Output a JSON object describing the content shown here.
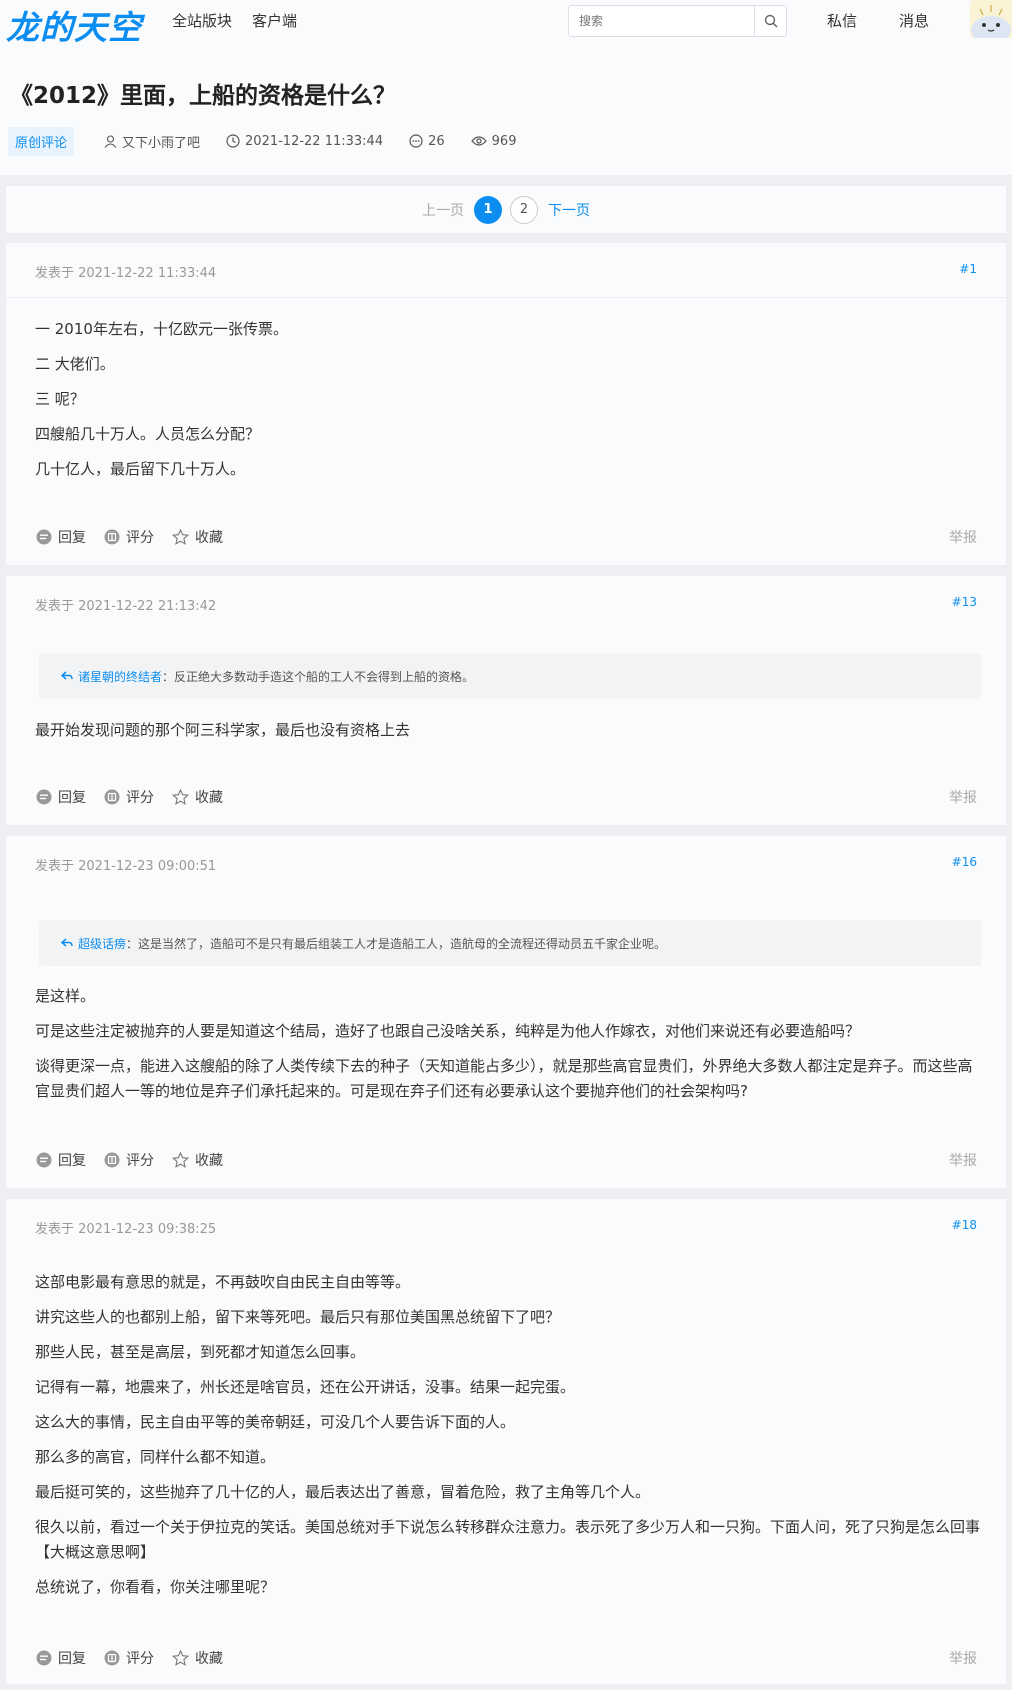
{
  "header": {
    "logo": "龙的天空",
    "nav": [
      "全站版块",
      "客户端"
    ],
    "search_placeholder": "搜索",
    "messages": "私信",
    "notifications": "消息"
  },
  "thread": {
    "title": "《2012》里面，上船的资格是什么？",
    "tag": "原创评论",
    "author": "又下小雨了吧",
    "datetime": "2021-12-22 11:33:44",
    "comments": "26",
    "views": "969"
  },
  "pagination": {
    "prev": "上一页",
    "pages": [
      "1",
      "2"
    ],
    "next": "下一页"
  },
  "actions": {
    "reply": "回复",
    "rate": "评分",
    "favorite": "收藏",
    "report": "举报"
  },
  "posts": [
    {
      "time": "发表于 2021-12-22 11:33:44",
      "floor": "#1",
      "quote": null,
      "paragraphs": [
        "一 2010年左右，十亿欧元一张传票。",
        "二 大佬们。",
        "三 呢？",
        "四艘船几十万人。人员怎么分配？",
        "几十亿人，最后留下几十万人。"
      ]
    },
    {
      "time": "发表于 2021-12-22 21:13:42",
      "floor": "#13",
      "quote": {
        "name": "诸星朝的终结者",
        "text": "：反正绝大多数动手造这个船的工人不会得到上船的资格。"
      },
      "paragraphs": [
        "最开始发现问题的那个阿三科学家，最后也没有资格上去"
      ]
    },
    {
      "time": "发表于 2021-12-23 09:00:51",
      "floor": "#16",
      "quote": {
        "name": "超级话痨",
        "text": "：这是当然了，造船可不是只有最后组装工人才是造船工人，造航母的全流程还得动员五千家企业呢。"
      },
      "paragraphs": [
        "是这样。",
        "可是这些注定被抛弃的人要是知道这个结局，造好了也跟自己没啥关系，纯粹是为他人作嫁衣，对他们来说还有必要造船吗？",
        "谈得更深一点，能进入这艘船的除了人类传续下去的种子（天知道能占多少），就是那些高官显贵们，外界绝大多数人都注定是弃子。而这些高官显贵们超人一等的地位是弃子们承托起来的。可是现在弃子们还有必要承认这个要抛弃他们的社会架构吗?"
      ]
    },
    {
      "time": "发表于 2021-12-23 09:38:25",
      "floor": "#18",
      "quote": null,
      "paragraphs": [
        "这部电影最有意思的就是，不再鼓吹自由民主自由等等。",
        "讲究这些人的也都别上船，留下来等死吧。最后只有那位美国黑总统留下了吧？",
        "那些人民，甚至是高层，到死都才知道怎么回事。",
        "记得有一幕，地震来了，州长还是啥官员，还在公开讲话，没事。结果一起完蛋。",
        "这么大的事情，民主自由平等的美帝朝廷，可没几个人要告诉下面的人。",
        "那么多的高官，同样什么都不知道。",
        "最后挺可笑的，这些抛弃了几十亿的人，最后表达出了善意，冒着危险，救了主角等几个人。",
        "很久以前，看过一个关于伊拉克的笑话。美国总统对手下说怎么转移群众注意力。表示死了多少万人和一只狗。下面人问，死了只狗是怎么回事【大概这意思啊】",
        "总统说了，你看看，你关注哪里呢？"
      ]
    }
  ]
}
